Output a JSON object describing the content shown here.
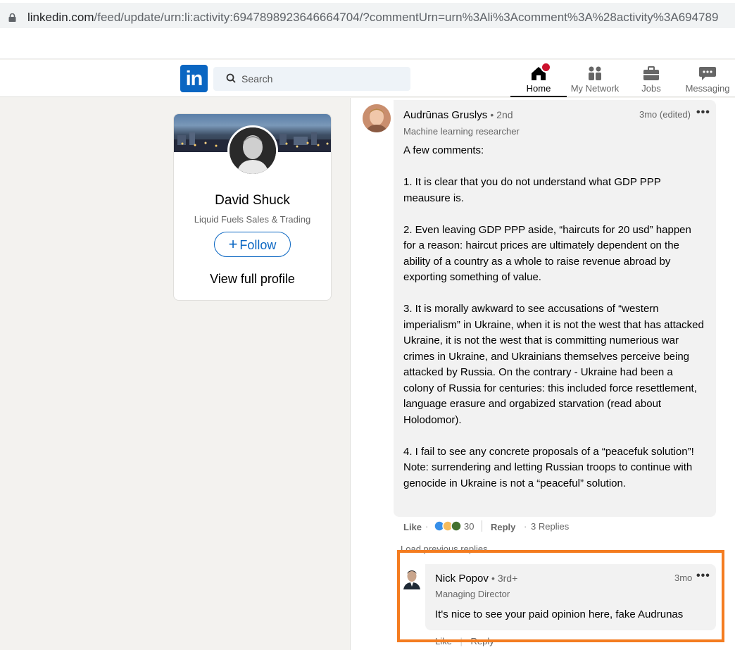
{
  "browser": {
    "url_main": "linkedin.com",
    "url_rest": "/feed/update/urn:li:activity:6947898923646664704/?commentUrn=urn%3Ali%3Acomment%3A%28activity%3A694789"
  },
  "nav": {
    "search_placeholder": "Search",
    "items": [
      {
        "label": "Home",
        "icon": "home-icon"
      },
      {
        "label": "My Network",
        "icon": "people-icon"
      },
      {
        "label": "Jobs",
        "icon": "briefcase-icon"
      },
      {
        "label": "Messaging",
        "icon": "chat-icon"
      }
    ]
  },
  "profile": {
    "name": "David Shuck",
    "headline": "Liquid Fuels Sales & Trading",
    "follow_label": "Follow",
    "view_profile_label": "View full profile"
  },
  "comment1": {
    "name": "Audrūnas Gruslys",
    "degree": "• 2nd",
    "headline": "Machine learning researcher",
    "time": "3mo (edited)",
    "paragraphs": [
      "A few comments:",
      "1. It is clear that you do not understand what GDP PPP meausure is.",
      "2. Even leaving GDP PPP aside, “haircuts for 20 usd” happen for a reason: haircut prices are ultimately dependent on the ability of a country as a whole to raise revenue abroad by exporting something of value.",
      "3. It is morally awkward to see accusations of “western imperialism” in Ukraine, when it is not the west that has attacked Ukraine, it is not the west that is committing numerious war crimes in Ukraine, and Ukrainians themselves perceive being attacked by Russia. On the contrary - Ukraine had been a colony of Russia for centuries: this included force resettlement, language erasure and orgabized starvation (read about Holodomor).",
      "4. I fail to see any concrete proposals of a “peacefuk solution”! Note: surrendering and letting Russian troops to continue with genocide in Ukraine is not a “peaceful” solution."
    ],
    "like_label": "Like",
    "reaction_count": "30",
    "reply_label": "Reply",
    "replies_label": "3 Replies"
  },
  "load_previous": "Load previous replies",
  "comment2": {
    "name": "Nick Popov",
    "degree": "• 3rd+",
    "headline": "Managing Director",
    "time": "3mo",
    "text": "It's nice to see your paid opinion here, fake Audrunas",
    "like_label": "Like",
    "reply_label": "Reply"
  },
  "colors": {
    "linkedin_blue": "#0a66c2",
    "highlight_orange": "#f47c20",
    "notification_red": "#cb112d"
  }
}
